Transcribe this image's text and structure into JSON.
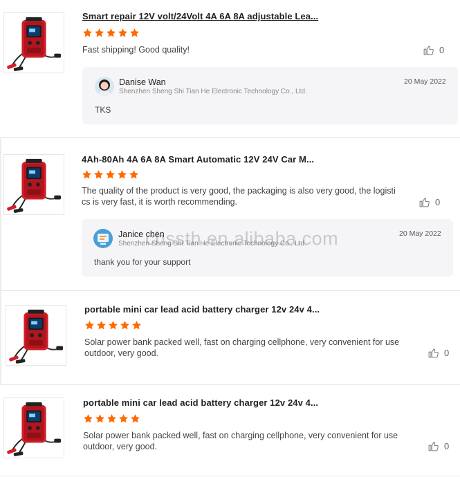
{
  "reviews": [
    {
      "product_title": "Smart repair 12V volt/24Volt 4A 6A 8A adjustable Lea...",
      "rating": 5,
      "text": "Fast shipping! Good quality!",
      "likes": "0",
      "reply": {
        "name": "Danise Wan",
        "company": "Shenzhen Sheng Shi Tian He Electronic Technology Co., Ltd.",
        "date": "20 May 2022",
        "text": "TKS"
      }
    },
    {
      "product_title": "4Ah-80Ah 4A 6A 8A Smart Automatic 12V 24V Car M...",
      "rating": 5,
      "text_line1": "The quality of the product is very good, the packaging is also very good, the logisti",
      "text_line2": "cs is very fast, it is worth recommending.",
      "likes": "0",
      "reply": {
        "name": "Janice chen",
        "company": "Shenzhen Sheng Shi Tian He Electronic Technology Co., Ltd.",
        "date": "20 May 2022",
        "text": "thank you for your support"
      }
    },
    {
      "product_title": "portable mini car lead acid battery charger 12v 24v 4...",
      "rating": 5,
      "text_line1": "Solar power bank packed well, fast on charging cellphone, very convenient for use",
      "text_line2": "outdoor, very good.",
      "likes": "0"
    },
    {
      "product_title": "portable mini car lead acid battery charger 12v 24v 4...",
      "rating": 5,
      "text_line1": "Solar power bank packed well, fast on charging cellphone, very convenient for use",
      "text_line2": "outdoor, very good.",
      "likes": "0"
    }
  ],
  "watermark": "chssth.en.alibaba.com",
  "colors": {
    "star": "#ff6a00",
    "reply_bg": "#f5f5f7",
    "product_red": "#d0202a"
  },
  "icons": {
    "like": "thumbs-up-icon",
    "star": "star-icon"
  }
}
